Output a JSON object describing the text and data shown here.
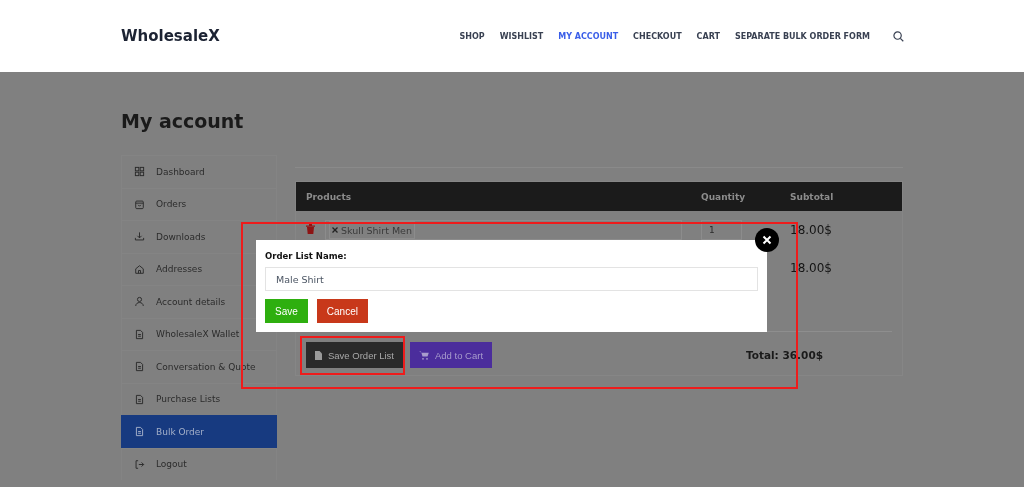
{
  "brand": "WholesaleX",
  "nav": [
    {
      "label": "SHOP",
      "selected": false
    },
    {
      "label": "WISHLIST",
      "selected": false
    },
    {
      "label": "MY ACCOUNT",
      "selected": true
    },
    {
      "label": "CHECKOUT",
      "selected": false
    },
    {
      "label": "CART",
      "selected": false
    },
    {
      "label": "SEPARATE BULK ORDER FORM",
      "selected": false
    }
  ],
  "page_title": "My account",
  "sidebar": [
    {
      "label": "Dashboard",
      "kind": "grid",
      "selected": false
    },
    {
      "label": "Orders",
      "kind": "bag",
      "selected": false
    },
    {
      "label": "Downloads",
      "kind": "download",
      "selected": false
    },
    {
      "label": "Addresses",
      "kind": "home",
      "selected": false
    },
    {
      "label": "Account details",
      "kind": "user",
      "selected": false
    },
    {
      "label": "WholesaleX Wallet",
      "kind": "doc",
      "selected": false
    },
    {
      "label": "Conversation & Quote",
      "kind": "doc",
      "selected": false
    },
    {
      "label": "Purchase Lists",
      "kind": "doc",
      "selected": false
    },
    {
      "label": "Bulk Order",
      "kind": "doc",
      "selected": true
    },
    {
      "label": "Logout",
      "kind": "logout",
      "selected": false
    }
  ],
  "table": {
    "columns": [
      "Products",
      "Quantity",
      "Subtotal"
    ],
    "rows": [
      {
        "product": "Skull Shirt Men",
        "quantity": "1",
        "subtotal": "18.00$"
      },
      {
        "subtotal": "18.00$"
      }
    ]
  },
  "actions": [
    {
      "label": "Save Order List",
      "kind": "save"
    },
    {
      "label": "Add to Cart",
      "kind": "cart"
    }
  ],
  "total": "Total: 36.00$",
  "modal": {
    "label": "Order List Name:",
    "value": "Male Shirt",
    "buttons": [
      {
        "label": "Save",
        "kind": "confirm"
      },
      {
        "label": "Cancel",
        "kind": "cancel"
      }
    ]
  }
}
